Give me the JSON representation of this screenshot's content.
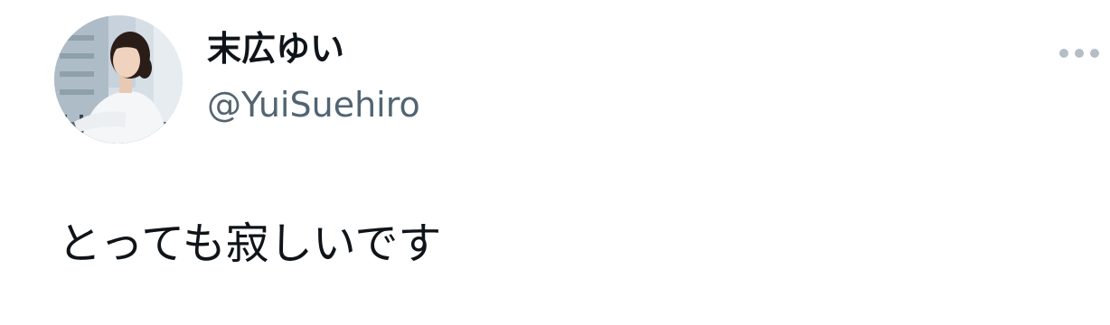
{
  "tweet": {
    "author": {
      "display_name": "末広ゆい",
      "handle": "@YuiSuehiro"
    },
    "text": "とっても寂しいです",
    "more_icon": "more-horizontal-icon"
  },
  "colors": {
    "text_primary": "#0f1419",
    "text_secondary": "#536471",
    "icon_muted": "#b6bec5",
    "background": "#ffffff"
  }
}
